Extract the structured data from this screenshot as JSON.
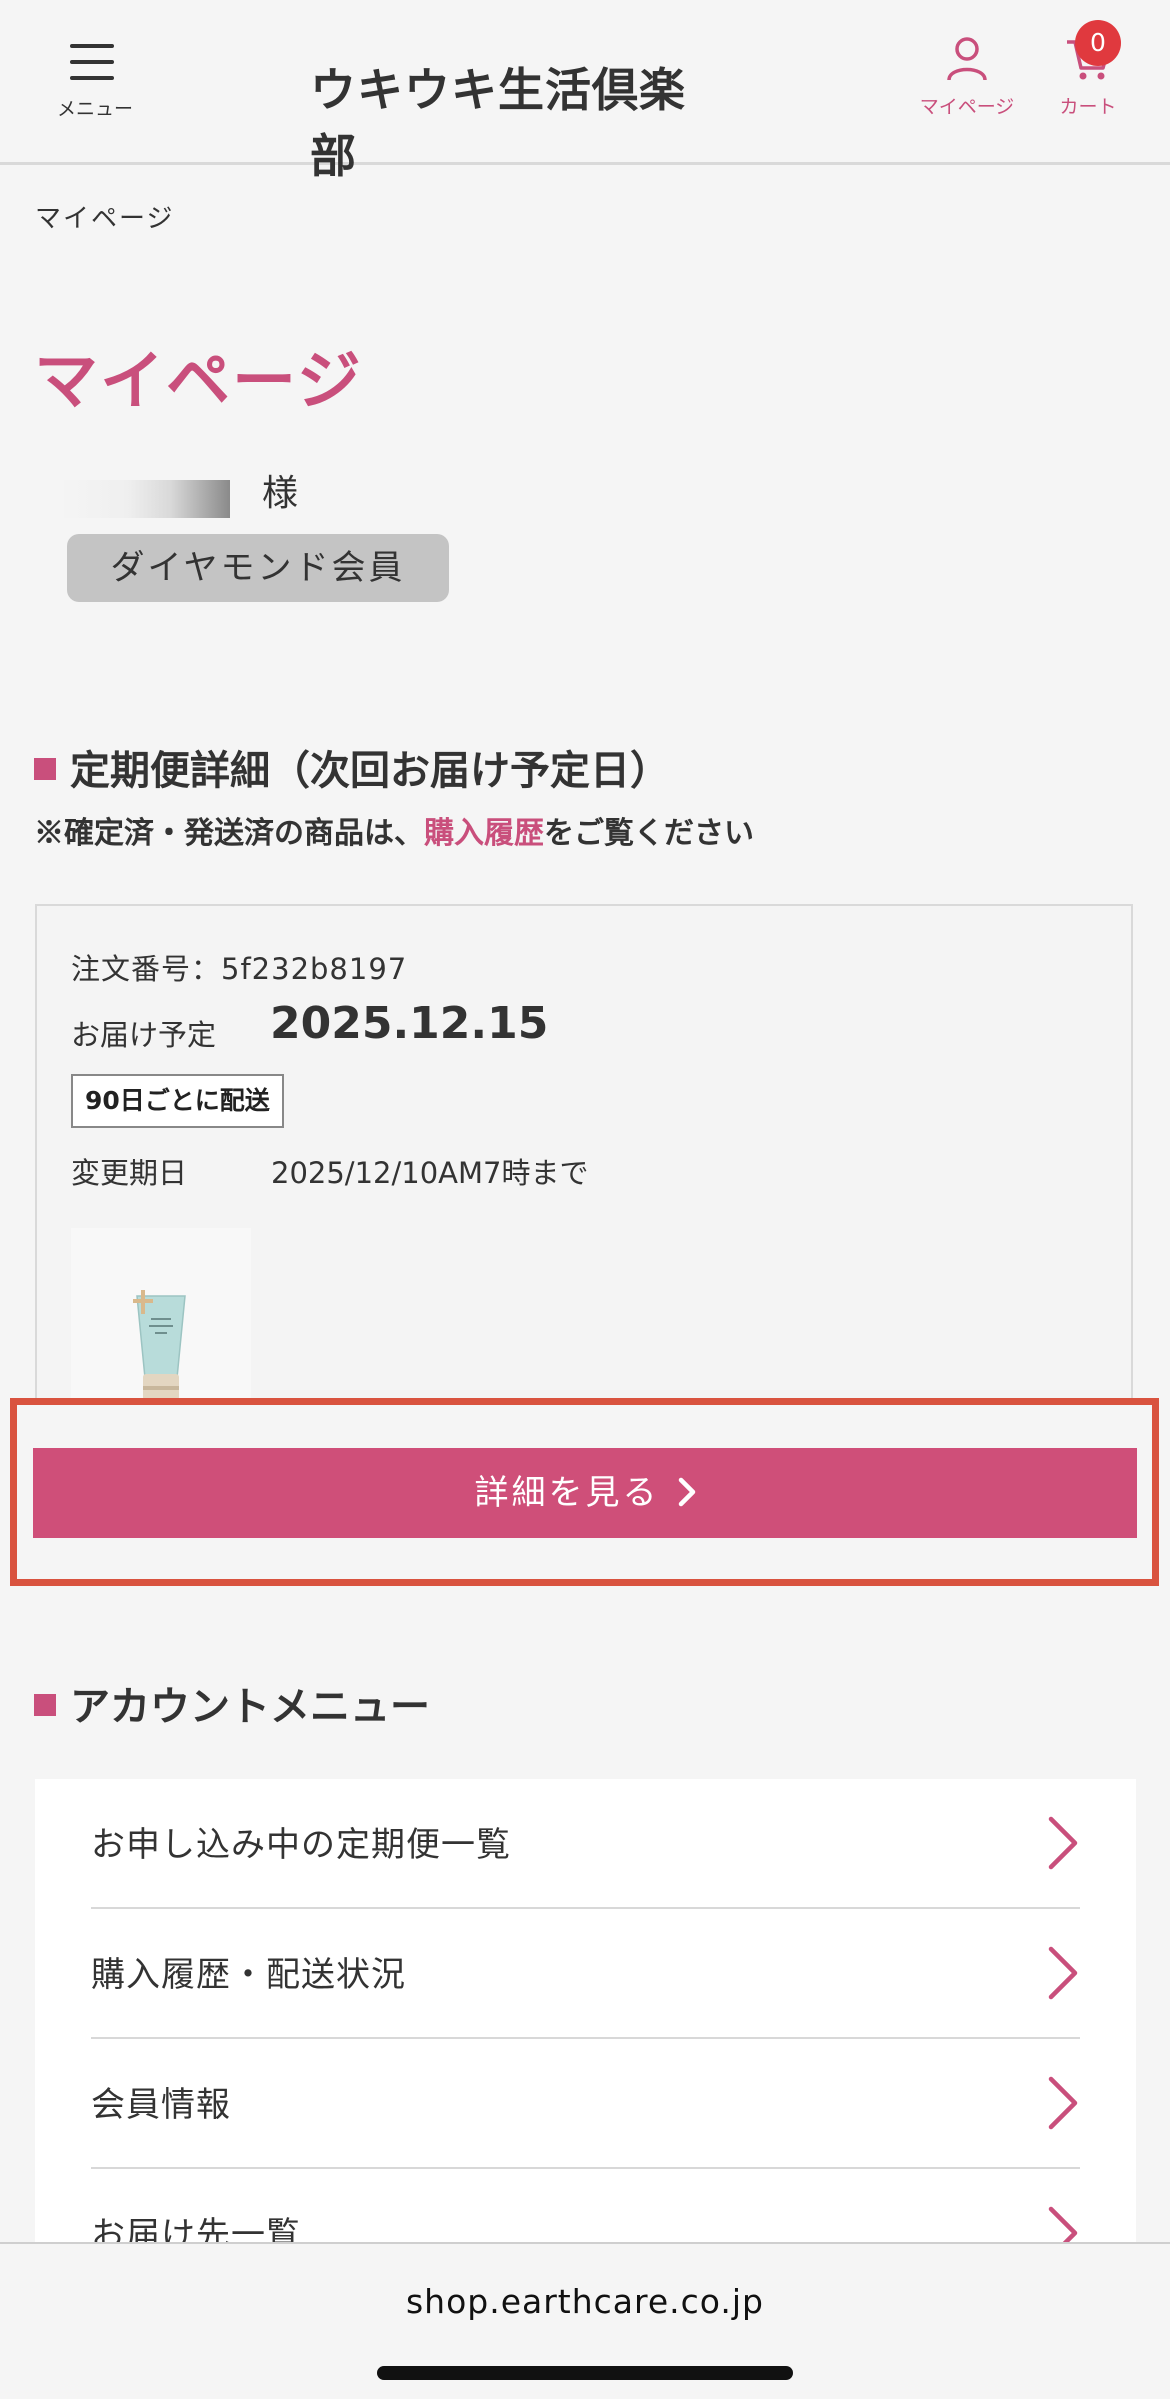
{
  "header": {
    "menu_label": "メニュー",
    "logo": "ウキウキ生活倶楽部",
    "mypage_label": "マイページ",
    "cart_label": "カート",
    "cart_count": "0",
    "accent": "#c94f7c"
  },
  "breadcrumb": "マイページ",
  "page_title": "マイページ",
  "user": {
    "honorific": "様",
    "rank": "ダイヤモンド会員"
  },
  "subscription": {
    "heading": "定期便詳細（次回お届け予定日）",
    "note_prefix": "※確定済・発送済の商品は、",
    "note_link": "購入履歴",
    "note_suffix": "をご覧ください",
    "order_number_label": "注文番号：",
    "order_number": "5f232b8197",
    "delivery_label": "お届け予定",
    "delivery_date": "2025.12.15",
    "interval": "90日ごとに配送",
    "change_label": "変更期日",
    "change_deadline": "2025/12/10AM7時まで",
    "detail_button": "詳細を見る"
  },
  "account_menu": {
    "heading": "アカウントメニュー",
    "items": [
      {
        "label": "お申し込み中の定期便一覧"
      },
      {
        "label": "購入履歴・配送状況"
      },
      {
        "label": "会員情報"
      },
      {
        "label": "お届け先一覧"
      }
    ]
  },
  "browser": {
    "url": "shop.earthcare.co.jp"
  }
}
